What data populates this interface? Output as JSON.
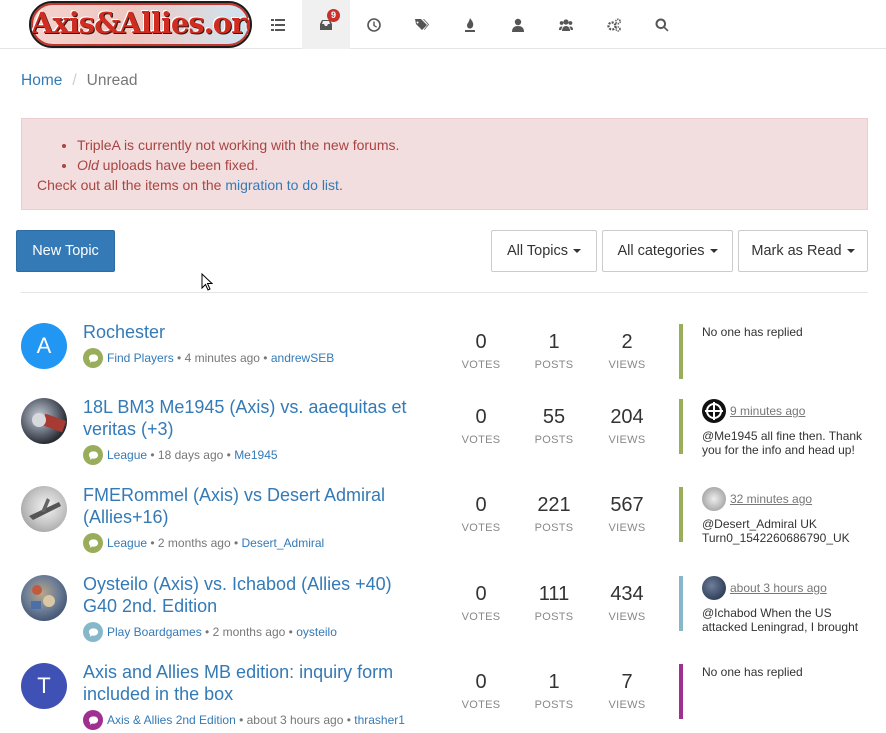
{
  "header": {
    "logo_text": "Axis&Allies.org",
    "notification_count": "9"
  },
  "breadcrumb": {
    "home": "Home",
    "current": "Unread"
  },
  "alert": {
    "line1": "TripleA is currently not working with the new forums.",
    "line2_em": "Old",
    "line2_rest": " uploads have been fixed.",
    "line3_pre": "Check out all the items on the ",
    "line3_link": "migration to do list",
    "line3_post": "."
  },
  "toolbar": {
    "new_topic": "New Topic",
    "filter_topics": "All Topics",
    "filter_categories": "All categories",
    "mark_read": "Mark as Read"
  },
  "stat_labels": {
    "votes": "VOTES",
    "posts": "POSTS",
    "views": "VIEWS"
  },
  "topics": [
    {
      "title": "Rochester",
      "avatar_letter": "A",
      "avatar_color": "#2196f3",
      "category": "Find Players",
      "category_color": "#9aad5a",
      "time": "4 minutes ago",
      "author": "andrewSEB",
      "votes": "0",
      "posts": "1",
      "views": "2",
      "bar_color": "#9aad5a",
      "teaser": "No one has replied"
    },
    {
      "title": "18L BM3 Me1945 (Axis) vs. aaequitas et veritas (+3)",
      "category": "League",
      "category_color": "#9aad5a",
      "time": "18 days ago",
      "author": "Me1945",
      "votes": "0",
      "posts": "55",
      "views": "204",
      "bar_color": "#9aad5a",
      "teaser_time": "9 minutes ago",
      "teaser": "@Me1945 all fine then. Thank you for the info and head up!"
    },
    {
      "title": "FMERommel (Axis) vs Desert Admiral (Allies+16)",
      "category": "League",
      "category_color": "#9aad5a",
      "time": "2 months ago",
      "author": "Desert_Admiral",
      "votes": "0",
      "posts": "221",
      "views": "567",
      "bar_color": "#9aad5a",
      "teaser_time": "32 minutes ago",
      "teaser": "@Desert_Admiral UK Turn0_1542260686790_UK"
    },
    {
      "title": "Oysteilo (Axis) vs. Ichabod (Allies +40) G40 2nd. Edition",
      "category": "Play Boardgames",
      "category_color": "#86b8c9",
      "time": "2 months ago",
      "author": "oysteilo",
      "votes": "0",
      "posts": "111",
      "views": "434",
      "bar_color": "#86b8c9",
      "teaser_time": "about 3 hours ago",
      "teaser": "@Ichabod When the US attacked Leningrad, I brought"
    },
    {
      "title": "Axis and Allies MB edition: inquiry form included in the box",
      "avatar_letter": "T",
      "avatar_color": "#3f51b5",
      "category": "Axis & Allies 2nd Edition",
      "category_color": "#a0308f",
      "time": "about 3 hours ago",
      "author": "thrasher1",
      "votes": "0",
      "posts": "1",
      "views": "7",
      "bar_color": "#a0308f",
      "teaser": "No one has replied"
    }
  ]
}
